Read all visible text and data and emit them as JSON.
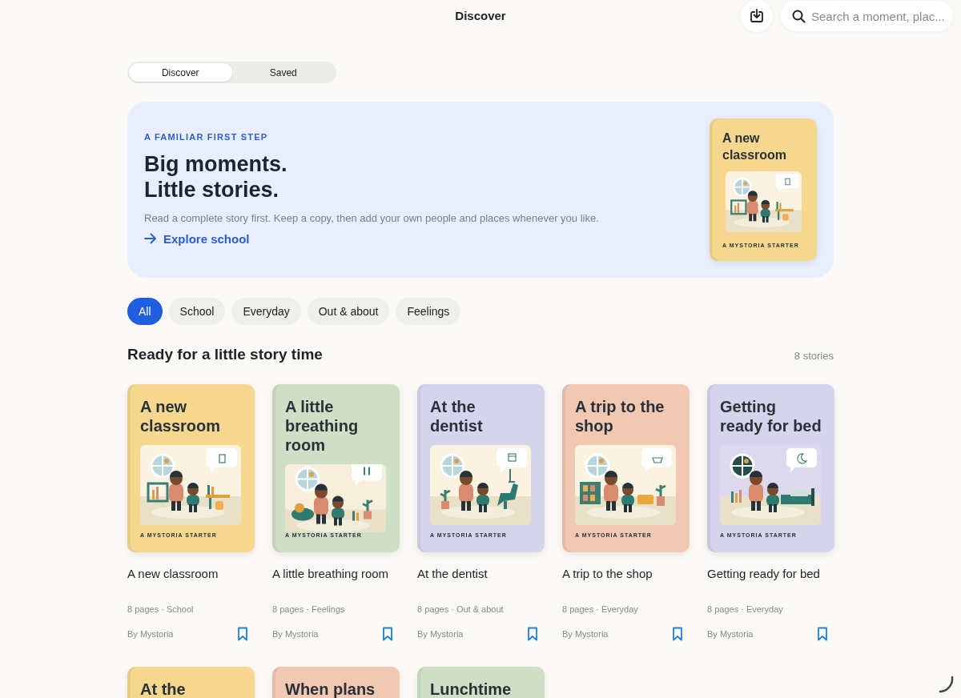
{
  "top_bar": {
    "title": "Discover",
    "search": {
      "placeholder": "Search a moment, plac..."
    }
  },
  "segments": [
    {
      "label": "Discover",
      "selected": true
    },
    {
      "label": "Saved",
      "selected": false
    }
  ],
  "hero": {
    "eyebrow": "A FAMILIAR FIRST STEP",
    "headline": [
      "Big moments.",
      "Little stories."
    ],
    "body": "Read a complete story first. Keep a copy, then add your own people and places whenever you like.",
    "link": "Explore school",
    "cover": {
      "title": "A new classroom",
      "kind": "school",
      "color": "#f5d88e",
      "label": "A MYSTORIA STARTER"
    }
  },
  "filters": [
    {
      "label": "All",
      "selected": true
    },
    {
      "label": "School",
      "selected": false
    },
    {
      "label": "Everyday",
      "selected": false
    },
    {
      "label": "Out & about",
      "selected": false
    },
    {
      "label": "Feelings",
      "selected": false
    }
  ],
  "section": {
    "title": "Ready for a little story time",
    "count": "8 stories"
  },
  "stories": [
    {
      "cover_title": "A new classroom",
      "kind": "school",
      "color": "#f5d88e",
      "label": "A MYSTORIA STARTER",
      "title": "A new classroom",
      "meta": "8 pages · School",
      "author": "By Mystoria"
    },
    {
      "cover_title": "A little breathing room",
      "kind": "calm",
      "color": "#cfdfc5",
      "label": "A MYSTORIA STARTER",
      "title": "A little breathing room",
      "meta": "8 pages · Feelings",
      "author": "By Mystoria"
    },
    {
      "cover_title": "At the dentist",
      "kind": "dentist",
      "color": "#d6d3ec",
      "label": "A MYSTORIA STARTER",
      "title": "At the dentist",
      "meta": "8 pages · Out & about",
      "author": "By Mystoria"
    },
    {
      "cover_title": "A trip to the shop",
      "kind": "shop",
      "color": "#f1c8b2",
      "label": "A MYSTORIA STARTER",
      "title": "A trip to the shop",
      "meta": "8 pages · Everyday",
      "author": "By Mystoria"
    },
    {
      "cover_title": "Getting ready for bed",
      "kind": "bed",
      "color": "#d6d3ec",
      "label": "A MYSTORIA STARTER",
      "title": "Getting ready for bed",
      "meta": "8 pages · Everyday",
      "author": "By Mystoria"
    }
  ],
  "more_stories": [
    {
      "cover_title": "At the",
      "color": "#f5d88e"
    },
    {
      "cover_title": "When plans",
      "color": "#f1c8b2"
    },
    {
      "cover_title": "Lunchtime",
      "color": "#cfdfc5"
    }
  ]
}
